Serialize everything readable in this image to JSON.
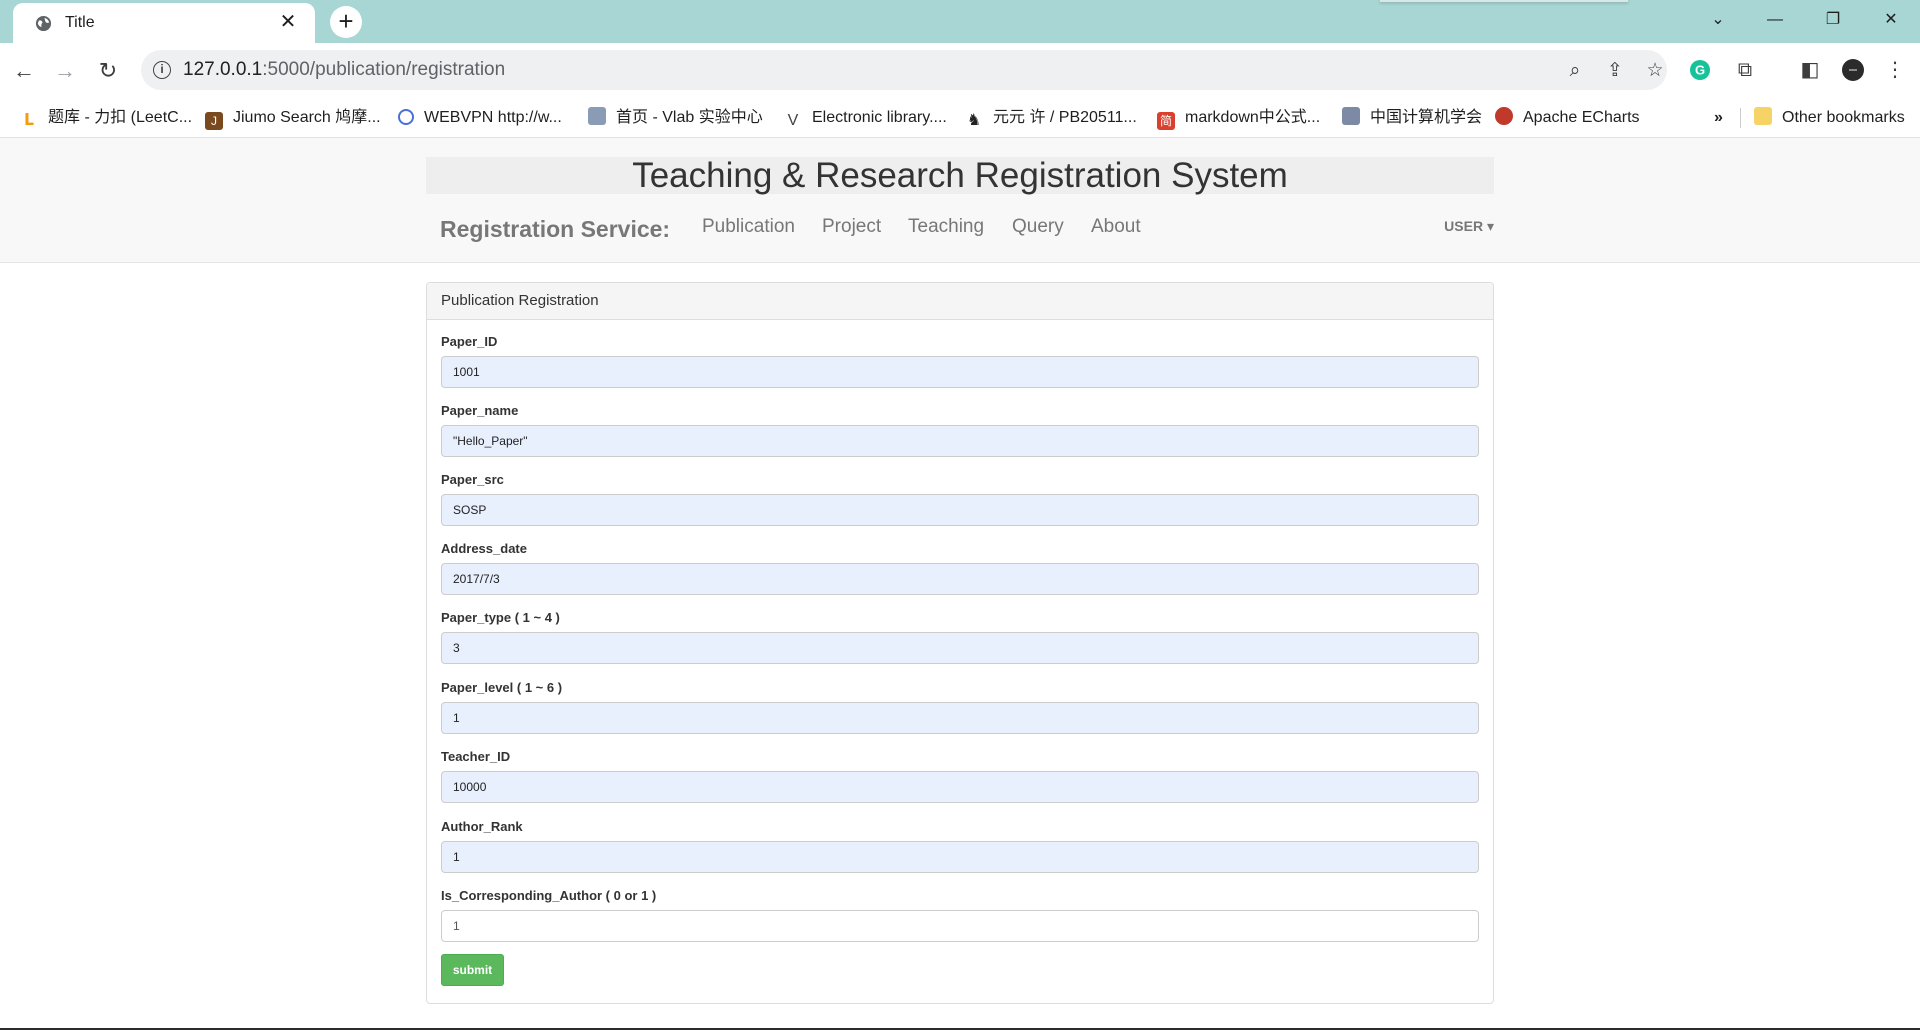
{
  "browser": {
    "tab_title": "Title",
    "url_host": "127.0.0.1",
    "url_rest": ":5000/publication/registration",
    "bookmarks": [
      {
        "label": "题库 - 力扣 (LeetC...",
        "color": "#f39c12"
      },
      {
        "label": "Jiumo Search 鸠摩...",
        "color": "#7a4a1e"
      },
      {
        "label": "WEBVPN http://w...",
        "color": "#4a6fd6"
      },
      {
        "label": "首页 - Vlab 实验中心",
        "color": "#8a9bb5"
      },
      {
        "label": "Electronic library....",
        "color": "#444444"
      },
      {
        "label": "元元 许 / PB20511...",
        "color": "#222222"
      },
      {
        "label": "markdown中公式...",
        "color": "#d9412e"
      },
      {
        "label": "中国计算机学会",
        "color": "#7d8aa5"
      },
      {
        "label": "Apache ECharts",
        "color": "#c0392b"
      }
    ],
    "bookmarks_overflow": "»",
    "other_bookmarks": "Other bookmarks"
  },
  "site": {
    "title": "Teaching & Research Registration System",
    "brand": "Registration Service:",
    "nav": [
      "Publication",
      "Project",
      "Teaching",
      "Query",
      "About"
    ],
    "user_menu": "USER ▾"
  },
  "form": {
    "heading": "Publication Registration",
    "fields": [
      {
        "label": "Paper_ID",
        "value": "1001"
      },
      {
        "label": "Paper_name",
        "value": "\"Hello_Paper\""
      },
      {
        "label": "Paper_src",
        "value": "SOSP"
      },
      {
        "label": "Address_date",
        "value": "2017/7/3"
      },
      {
        "label": "Paper_type ( 1 ~ 4 )",
        "value": "3"
      },
      {
        "label": "Paper_level ( 1 ~ 6 )",
        "value": "1"
      },
      {
        "label": "Teacher_ID",
        "value": "10000"
      },
      {
        "label": "Author_Rank",
        "value": "1"
      },
      {
        "label": "Is_Corresponding_Author ( 0 or 1 )",
        "value": "1"
      }
    ],
    "submit_label": "submit"
  }
}
